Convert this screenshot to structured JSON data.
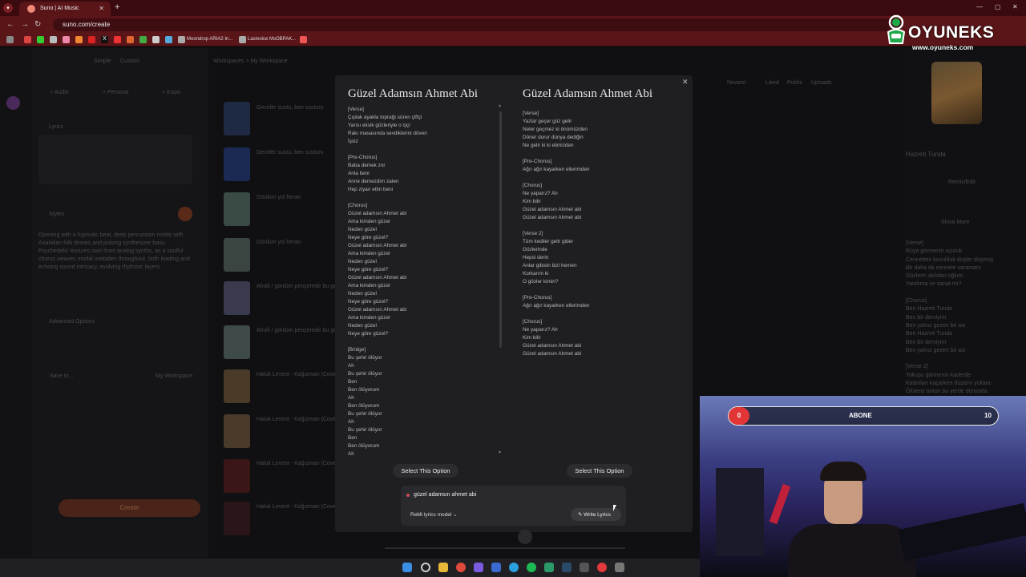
{
  "browser": {
    "tab_title": "Suno | AI Music",
    "url": "suno.com/create",
    "bookmarks": [
      {
        "label": "Moondrop ARIA2 In..."
      },
      {
        "label": "Lastvoice MsOBPAK..."
      }
    ]
  },
  "background_app": {
    "left_tabs": [
      "Simple",
      "Custom"
    ],
    "breadcrumb": "Workspaces  >  My Workspace",
    "toolbar": [
      "Newest",
      "Liked",
      "Public",
      "Uploads"
    ],
    "left_actions": [
      "+ Audio",
      "+ Persona",
      "+ Inspo"
    ],
    "lyrics_label": "Lyrics",
    "styles_label": "Styles",
    "style_text": "Opening with a hypnotic beat, deep percussion melds with Anatolian folk drones and pulsing synthesizer bass. Psychedelic textures swirl from analog synths, as a soulful chorus weaves modal melodies throughout, both leading and echoing sound intricacy, evolving rhythmic layers",
    "advanced_label": "Advanced Options",
    "save_label": "Save to...",
    "workspace_label": "My Workspace",
    "create_label": "Create",
    "songs": [
      {
        "title": "Geceler sustu, ben sustum"
      },
      {
        "title": "Geceler sustu, ben sustum"
      },
      {
        "title": "Gönlüm yol heran"
      },
      {
        "title": "Gönlüm yol heran"
      },
      {
        "title": "Ahvili / gönlüm pençeredir bu ge"
      },
      {
        "title": "Ahvili / gönlüm pençeredir bu ge"
      },
      {
        "title": "Haluk Levent - Kağızman (Cover)"
      },
      {
        "title": "Haluk Levent - Kağızman (Cover)"
      },
      {
        "title": "Haluk Levent - Kağızman (Cover)"
      },
      {
        "title": "Haluk Levent - Kağızman (Cover)"
      }
    ],
    "right_panel": {
      "song_title": "Hazreti Tunda",
      "remix_label": "Remix/Edit",
      "show_more": "Show More",
      "lyrics": "[Verse]\nRüya görmenin uçuruk\nCennetten kovulduk düşler düşmüş\nBir daha da cennete varamam\nGözlerin aklıdan oğlum\nYandıma ve sanat mı?\n\n[Chorus]\nBen Hazreti Tunda\nBen bir derviyim\nBen yalnız gezen bir ası\nBen Hazreti Tunda\nBen bir derviyim\nBen yalnız gezen bir ası\n\n[Verse 2]\nYokuşu görmenin kaderde\nKadınları kaçarken düştüm yollara\nÖlüleriz tortun bu yerde dünyada"
    }
  },
  "modal": {
    "option1": {
      "title": "Güzel Adamsın Ahmet Abi",
      "lyrics": "[Verse]\nÇıplak ayakla toprağı süren çiftçi\nYarısı eksik gözleriyle o işçi\nRakı masasında sevdiklerini döven\nİşsiz\n\n[Pre-Chorus]\nBaba demek zor\nAnla beni\nAnne demezdim zaten\nHep ziyan ettin beni\n\n[Chorus]\nGüzel adamsın Ahmet abi\nAma kimden güzel\nNeden güzel\nNeye göre güzel?\nGüzel adamsın Ahmet abi\nAma kimden güzel\nNeden güzel\nNeye göre güzel?\nGüzel adamsın Ahmet abi\nAma kimden güzel\nNeden güzel\nNeye göre güzel?\nGüzel adamsın Ahmet abi\nAma kimden güzel\nNeden güzel\nNeye göre güzel?\n\n[Bridge]\nBu şehir ölüyor\nAh\nBu şehir ölüyor\nBen\nBen ölüyorum\nAh\nBen ölüyorum\nBu şehir ölüyor\nAh\nBu şehir ölüyor\nBen\nBen ölüyorum\nAh",
      "select_label": "Select This Option"
    },
    "option2": {
      "title": "Güzel Adamsın Ahmet Abi",
      "lyrics": "[Verse]\nYazlar geçer güz gelir\nNeler geçmez ki önümüzden\nDöner durur dünya dediğin\nNe gelir ki ki elimizden\n\n[Pre-Chorus]\nAğır ağır kayarken ellerimden\n\n[Chorus]\nNe yaparız? Ah\nKim bilir\nGüzel adamsın Ahmet abi\nGüzel adamsın Ahmet abi\n\n[Verse 2]\nTüm kediler gelir gider\nGözlerinde\nHepsi derin\nAnlar gibisin bizi hemen\nKorkarım ki\nO gözler kimin?\n\n[Pre-Chorus]\nAğır ağır kayarken ellerimden\n\n[Chorus]\nNe yaparız? Ah\nKim bilir\nGüzel adamsın Ahmet abi\nGüzel adamsın Ahmet abi",
      "select_label": "Select This Option"
    },
    "prompt": "güzel adamsın ahmet abi",
    "model_label": "ReMi lyrics model",
    "write_label": "Write Lyrics"
  },
  "overlay": {
    "logo_name": "OYUNEKS",
    "logo_site": "www.oyuneks.com",
    "sub_count": "0",
    "sub_label": "ABONE",
    "sub_goal": "10"
  },
  "colors": {
    "tabbar": "#3a0a0e",
    "chrome": "#5a1519",
    "accent_create": "#e0673a",
    "sub_red": "#e23636"
  }
}
